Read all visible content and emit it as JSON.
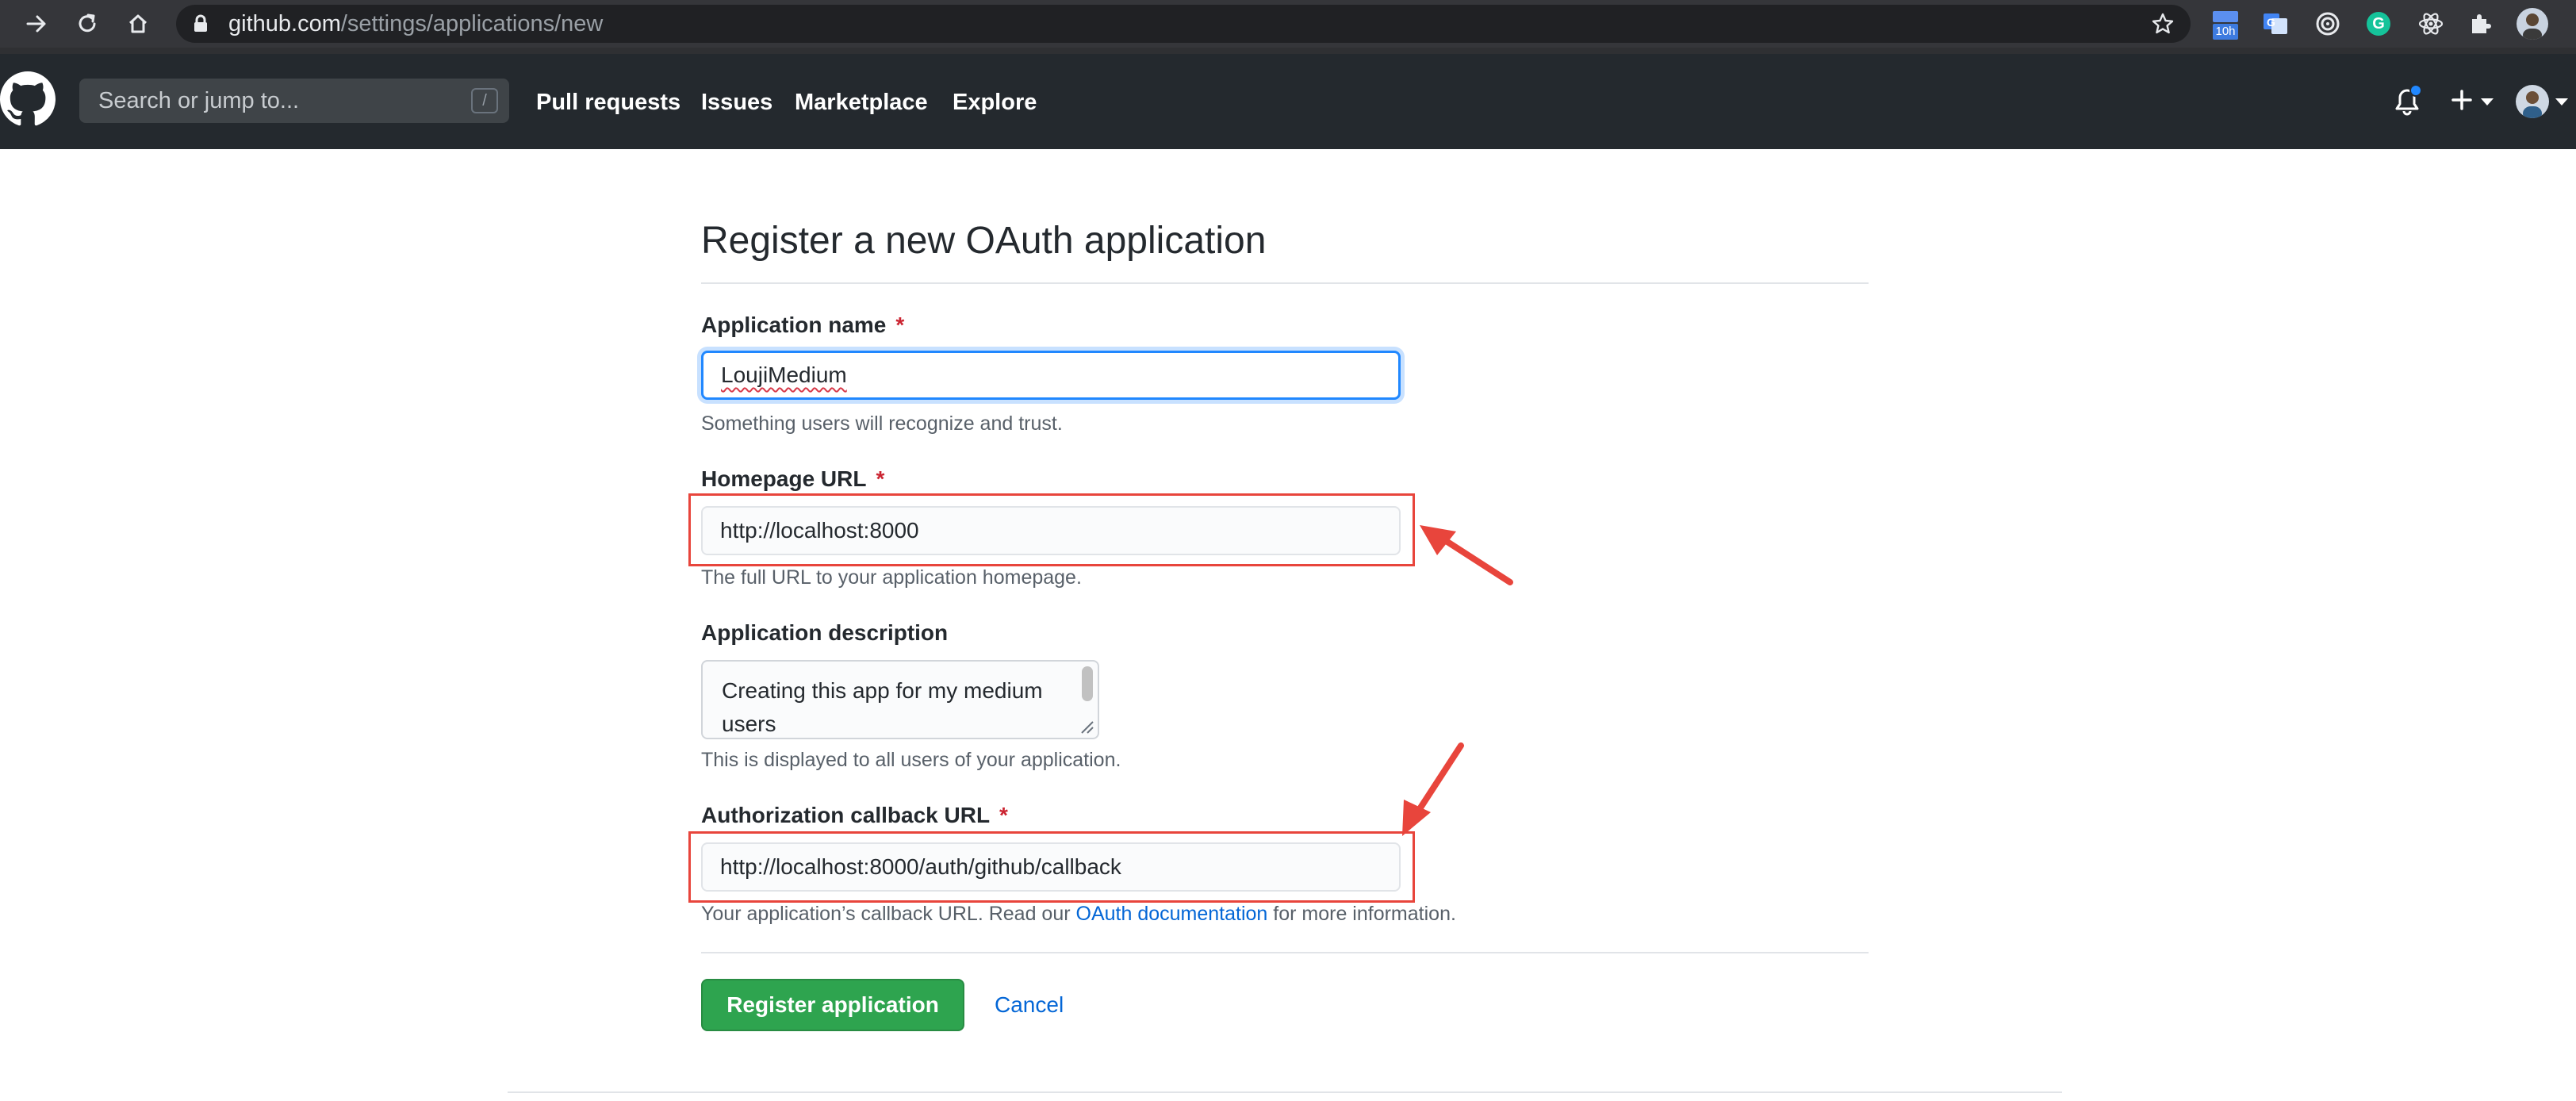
{
  "browser": {
    "url_host": "github.com",
    "url_path": "/settings/applications/new",
    "extension_badge": "10h",
    "extension_grammarly": "G"
  },
  "header": {
    "search_placeholder": "Search or jump to...",
    "search_shortcut": "/",
    "nav": [
      "Pull requests",
      "Issues",
      "Marketplace",
      "Explore"
    ]
  },
  "form": {
    "title": "Register a new OAuth application",
    "required_mark": "*",
    "app_name": {
      "label": "Application name",
      "value": "LoujiMedium",
      "hint": "Something users will recognize and trust."
    },
    "homepage": {
      "label": "Homepage URL",
      "value": "http://localhost:8000",
      "hint": "The full URL to your application homepage."
    },
    "description": {
      "label": "Application description",
      "value": "Creating this app for my medium users",
      "hint": "This is displayed to all users of your application."
    },
    "callback": {
      "label": "Authorization callback URL",
      "value": "http://localhost:8000/auth/github/callback",
      "hint_prefix": "Your application’s callback URL. Read our ",
      "hint_link": "OAuth documentation",
      "hint_suffix": " for more information."
    },
    "submit_label": "Register application",
    "cancel_label": "Cancel"
  },
  "colors": {
    "annotation": "#e8453c",
    "primary_button": "#2ea44f",
    "link": "#0366d6",
    "header_bg": "#24292e"
  },
  "icons": [
    "forward-icon",
    "reload-icon",
    "home-icon",
    "lock-icon",
    "bookmark-star-icon",
    "github-logo-icon",
    "bell-icon",
    "plus-icon",
    "caret-down-icon",
    "avatar",
    "arrow-annotation"
  ]
}
